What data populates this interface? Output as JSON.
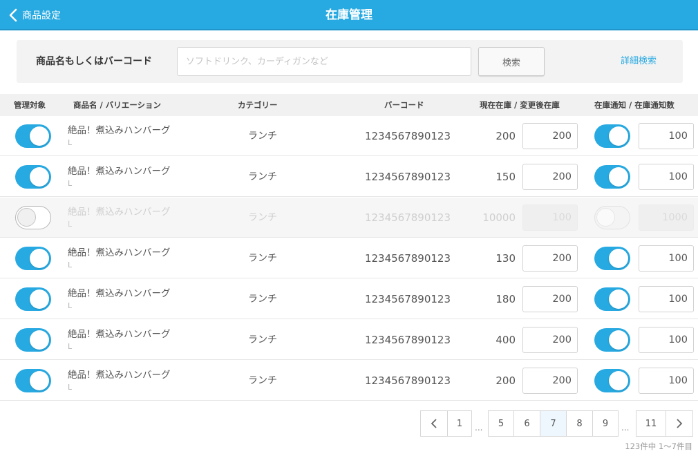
{
  "header": {
    "back_label": "商品設定",
    "title": "在庫管理"
  },
  "search": {
    "label": "商品名もしくはバーコード",
    "placeholder": "ソフトドリンク、カーディガンなど",
    "button": "検索",
    "advanced": "詳細検索"
  },
  "columns": {
    "managed": "管理対象",
    "name": "商品名 / バリエーション",
    "category": "カテゴリー",
    "barcode": "バーコード",
    "stock": "現在在庫 / 変更後在庫",
    "notify": "在庫通知 / 在庫通知数"
  },
  "rows": [
    {
      "managed": true,
      "name": "絶品！煮込みハンバーグ",
      "variation": "L",
      "category": "ランチ",
      "barcode": "1234567890123",
      "current_stock": "200",
      "new_stock": "200",
      "notify": true,
      "notify_count": "100"
    },
    {
      "managed": true,
      "name": "絶品！煮込みハンバーグ",
      "variation": "L",
      "category": "ランチ",
      "barcode": "1234567890123",
      "current_stock": "150",
      "new_stock": "200",
      "notify": true,
      "notify_count": "100"
    },
    {
      "managed": false,
      "name": "絶品！煮込みハンバーグ",
      "variation": "L",
      "category": "ランチ",
      "barcode": "1234567890123",
      "current_stock": "10000",
      "new_stock": "100",
      "notify": false,
      "notify_count": "1000"
    },
    {
      "managed": true,
      "name": "絶品！煮込みハンバーグ",
      "variation": "L",
      "category": "ランチ",
      "barcode": "1234567890123",
      "current_stock": "130",
      "new_stock": "200",
      "notify": true,
      "notify_count": "100"
    },
    {
      "managed": true,
      "name": "絶品！煮込みハンバーグ",
      "variation": "L",
      "category": "ランチ",
      "barcode": "1234567890123",
      "current_stock": "180",
      "new_stock": "200",
      "notify": true,
      "notify_count": "100"
    },
    {
      "managed": true,
      "name": "絶品！煮込みハンバーグ",
      "variation": "L",
      "category": "ランチ",
      "barcode": "1234567890123",
      "current_stock": "400",
      "new_stock": "200",
      "notify": true,
      "notify_count": "100"
    },
    {
      "managed": true,
      "name": "絶品！煮込みハンバーグ",
      "variation": "L",
      "category": "ランチ",
      "barcode": "1234567890123",
      "current_stock": "200",
      "new_stock": "200",
      "notify": true,
      "notify_count": "100"
    }
  ],
  "pagination": {
    "pages": [
      "1",
      "5",
      "6",
      "7",
      "8",
      "9",
      "11"
    ],
    "current": "7",
    "ellipsis": "...",
    "summary": "123件中 1〜7件目"
  },
  "colors": {
    "accent": "#27a9e1",
    "toggle_on": "#27a9e1",
    "toggle_off": "#ffffff"
  },
  "icons": {
    "back": "chevron-left-icon",
    "prev": "chevron-left-icon",
    "next": "chevron-right-icon"
  }
}
